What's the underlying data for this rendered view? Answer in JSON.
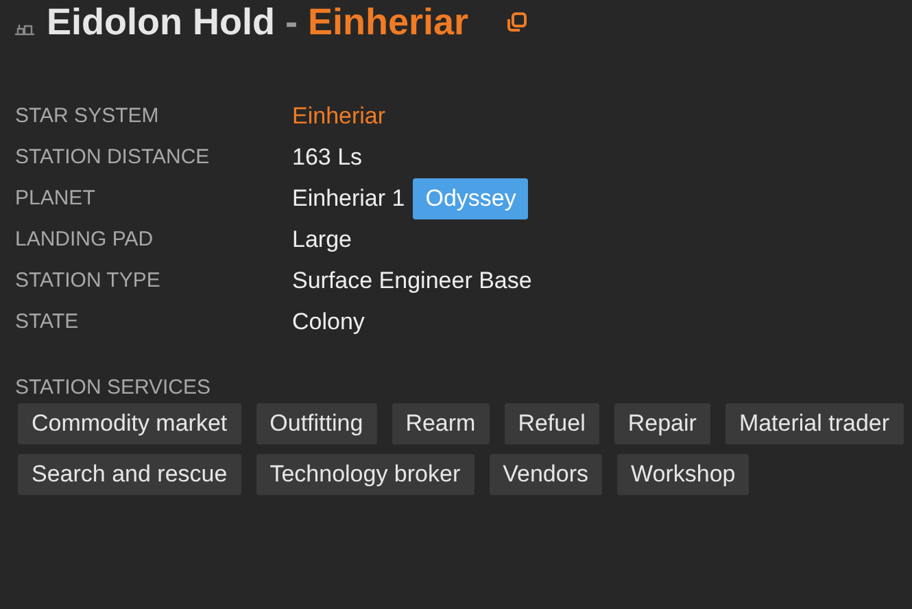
{
  "title": {
    "station": "Eidolon Hold",
    "separator": "-",
    "system": "Einheriar"
  },
  "details": [
    {
      "label": "STAR SYSTEM",
      "value": "Einheriar",
      "kind": "link"
    },
    {
      "label": "STATION DISTANCE",
      "value": "163 Ls",
      "kind": "text"
    },
    {
      "label": "PLANET",
      "value": "Einheriar 1",
      "kind": "text",
      "badge": "Odyssey"
    },
    {
      "label": "LANDING PAD",
      "value": "Large",
      "kind": "text"
    },
    {
      "label": "STATION TYPE",
      "value": "Surface Engineer Base",
      "kind": "text"
    },
    {
      "label": "STATE",
      "value": "Colony",
      "kind": "text"
    }
  ],
  "services": {
    "heading": "STATION SERVICES",
    "items": [
      "Commodity market",
      "Outfitting",
      "Rearm",
      "Refuel",
      "Repair",
      "Material trader",
      "Search and rescue",
      "Technology broker",
      "Vendors",
      "Workshop"
    ]
  }
}
